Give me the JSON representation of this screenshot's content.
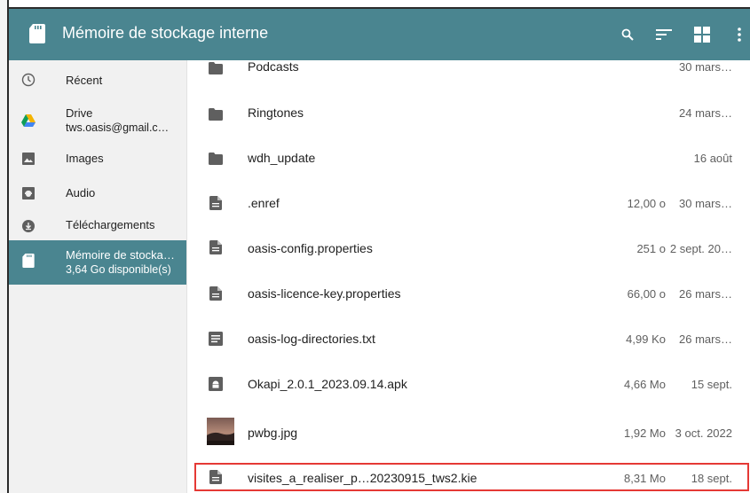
{
  "toolbar": {
    "title": "Mémoire de stockage interne",
    "icons": [
      "sd-card-icon",
      "search-icon",
      "sort-icon",
      "grid-view-icon",
      "more-vert-icon"
    ],
    "color": "#4a8590"
  },
  "sidebar": {
    "items": [
      {
        "label": "Récent",
        "sub": "",
        "icon": "clock-icon"
      },
      {
        "label": "Drive",
        "sub": "tws.oasis@gmail.c…",
        "icon": "drive-icon"
      },
      {
        "label": "Images",
        "sub": "",
        "icon": "image-icon"
      },
      {
        "label": "Audio",
        "sub": "",
        "icon": "audio-icon"
      },
      {
        "label": "Téléchargements",
        "sub": "",
        "icon": "download-icon"
      },
      {
        "label": "Mémoire de stocka…",
        "sub": "3,64 Go disponible(s)",
        "icon": "sd-card-icon",
        "active": true
      }
    ]
  },
  "files": [
    {
      "name": "Podcasts",
      "size": "",
      "date": "30 mars…",
      "type": "folder"
    },
    {
      "name": "Ringtones",
      "size": "",
      "date": "24 mars…",
      "type": "folder"
    },
    {
      "name": "wdh_update",
      "size": "",
      "date": "16 août",
      "type": "folder"
    },
    {
      "name": ".enref",
      "size": "12,00 o",
      "date": "30 mars…",
      "type": "file"
    },
    {
      "name": "oasis-config.properties",
      "size": "251 o",
      "date": "2 sept. 20…",
      "type": "file"
    },
    {
      "name": "oasis-licence-key.properties",
      "size": "66,00 o",
      "date": "26 mars…",
      "type": "file"
    },
    {
      "name": "oasis-log-directories.txt",
      "size": "4,99 Ko",
      "date": "26 mars…",
      "type": "text"
    },
    {
      "name": "Okapi_2.0.1_2023.09.14.apk",
      "size": "4,66 Mo",
      "date": "15 sept.",
      "type": "apk"
    },
    {
      "name": "pwbg.jpg",
      "size": "1,92 Mo",
      "date": "3 oct. 2022",
      "type": "image"
    },
    {
      "name": "visites_a_realiser_p…20230915_tws2.kie",
      "size": "8,31 Mo",
      "date": "18 sept.",
      "type": "file",
      "highlighted": true
    }
  ]
}
